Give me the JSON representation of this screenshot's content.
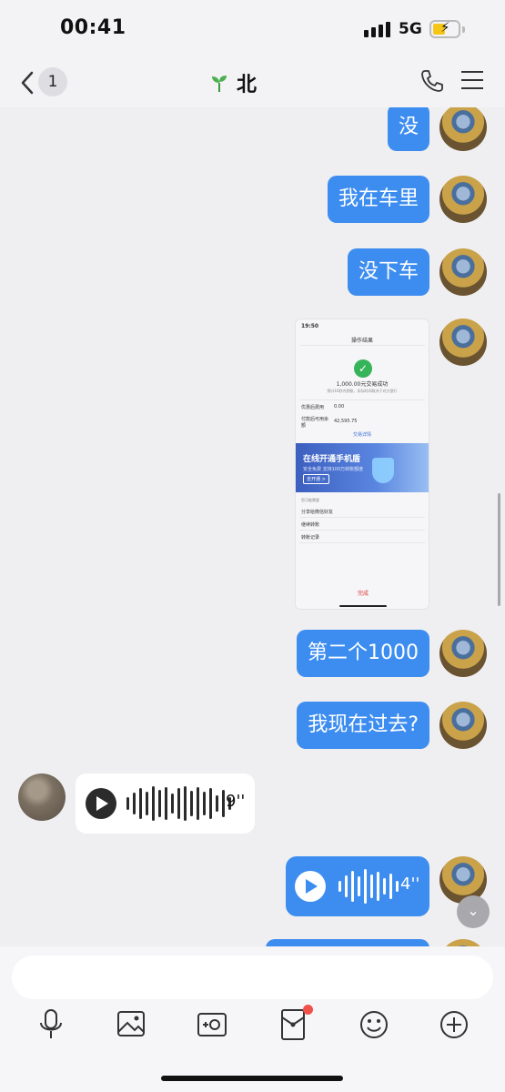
{
  "status_bar": {
    "time": "00:41",
    "network": "5G",
    "battery_charging": true
  },
  "nav": {
    "unread_badge": "1",
    "title": "北",
    "icons": [
      "back-icon",
      "sprout-icon",
      "phone-icon",
      "menu-icon"
    ]
  },
  "messages": [
    {
      "side": "right",
      "type": "text",
      "text": "没"
    },
    {
      "side": "right",
      "type": "text",
      "text": "我在车里"
    },
    {
      "side": "right",
      "type": "text",
      "text": "没下车"
    },
    {
      "side": "right",
      "type": "image",
      "image": {
        "time": "19:50",
        "header": "操作结果",
        "result": "1,000.00元交易成功",
        "result_note": "预计10秒内到账，实际时间取决于对方银行",
        "fee_label": "优惠后费用",
        "fee_value": "0.00",
        "balance_label": "付款后可用余额",
        "balance_value": "42,595.75",
        "details_link": "交易详情",
        "banner_title": "在线开通手机盾",
        "banner_subtitle": "安全免费 支持100万转账额度",
        "banner_button": "去开通 >",
        "section_label": "您可能需要",
        "links": [
          "分享给微信好友",
          "继续转账",
          "转账记录"
        ],
        "done": "完成"
      }
    },
    {
      "side": "right",
      "type": "text",
      "text": "第二个1000"
    },
    {
      "side": "right",
      "type": "text",
      "text": "我现在过去?"
    },
    {
      "side": "left",
      "type": "voice",
      "duration": "9''"
    },
    {
      "side": "right",
      "type": "voice",
      "duration": "4''"
    }
  ],
  "input": {
    "placeholder": "",
    "value": ""
  },
  "toolbar": [
    "mic-icon",
    "photo-icon",
    "camera-icon",
    "red-packet-icon",
    "emoji-icon",
    "plus-icon"
  ],
  "colors": {
    "bubble_blue": "#3d8df0",
    "background": "#efeff1",
    "notification_red": "#f0524a",
    "battery_yellow": "#f5c518"
  }
}
